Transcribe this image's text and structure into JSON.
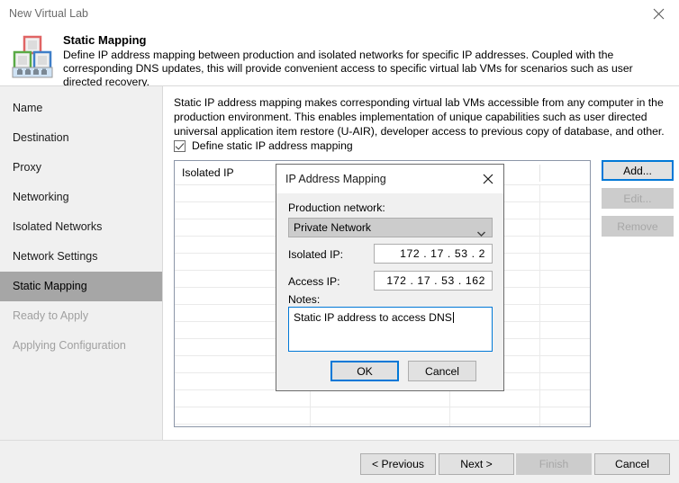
{
  "window": {
    "title": "New Virtual Lab",
    "close_icon": "close-icon"
  },
  "header": {
    "title": "Static Mapping",
    "description": "Define IP address mapping between production and isolated networks for specific IP addresses. Coupled with the corresponding DNS updates, this will provide convenient access to specific virtual lab VMs for scenarios such as user directed recovery.",
    "icon": "virtual-lab-icon"
  },
  "sidebar": {
    "items": [
      {
        "label": "Name",
        "state": "normal"
      },
      {
        "label": "Destination",
        "state": "normal"
      },
      {
        "label": "Proxy",
        "state": "normal"
      },
      {
        "label": "Networking",
        "state": "normal"
      },
      {
        "label": "Isolated Networks",
        "state": "normal"
      },
      {
        "label": "Network Settings",
        "state": "normal"
      },
      {
        "label": "Static Mapping",
        "state": "active"
      },
      {
        "label": "Ready to Apply",
        "state": "disabled"
      },
      {
        "label": "Applying Configuration",
        "state": "disabled"
      }
    ]
  },
  "main": {
    "description": "Static IP address mapping makes corresponding virtual lab VMs accessible from any computer in the production environment. This enables implementation of unique capabilities such as user directed universal application item restore (U-AIR), developer access to previous copy of database, and other.",
    "define_checkbox": {
      "label": "Define static IP address mapping",
      "checked": true
    },
    "table": {
      "columns": [
        "Isolated IP",
        "",
        "",
        ""
      ],
      "rows": [],
      "row_count": 15
    },
    "buttons": [
      {
        "label": "Add...",
        "state": "default"
      },
      {
        "label": "Edit...",
        "state": "disabled"
      },
      {
        "label": "Remove",
        "state": "disabled"
      }
    ]
  },
  "dialog": {
    "title": "IP Address Mapping",
    "close_icon": "close-icon",
    "production_network": {
      "label": "Production network:",
      "value": "Private Network",
      "arrow_icon": "chevron-down-icon"
    },
    "isolated_ip": {
      "label": "Isolated IP:",
      "value": "172 . 17 . 53 .   2"
    },
    "access_ip": {
      "label": "Access IP:",
      "value": "172 . 17 . 53 . 162"
    },
    "notes": {
      "label": "Notes:",
      "value": "Static IP address to access DNS"
    },
    "ok_label": "OK",
    "cancel_label": "Cancel"
  },
  "footer": {
    "buttons": [
      {
        "label": "< Previous",
        "state": "normal"
      },
      {
        "label": "Next >",
        "state": "normal"
      },
      {
        "label": "Finish",
        "state": "disabled"
      },
      {
        "label": "Cancel",
        "state": "normal"
      }
    ]
  },
  "colors": {
    "accent": "#0078d7",
    "active_nav": "#a6a6a6",
    "panel": "#f0f0f0"
  }
}
